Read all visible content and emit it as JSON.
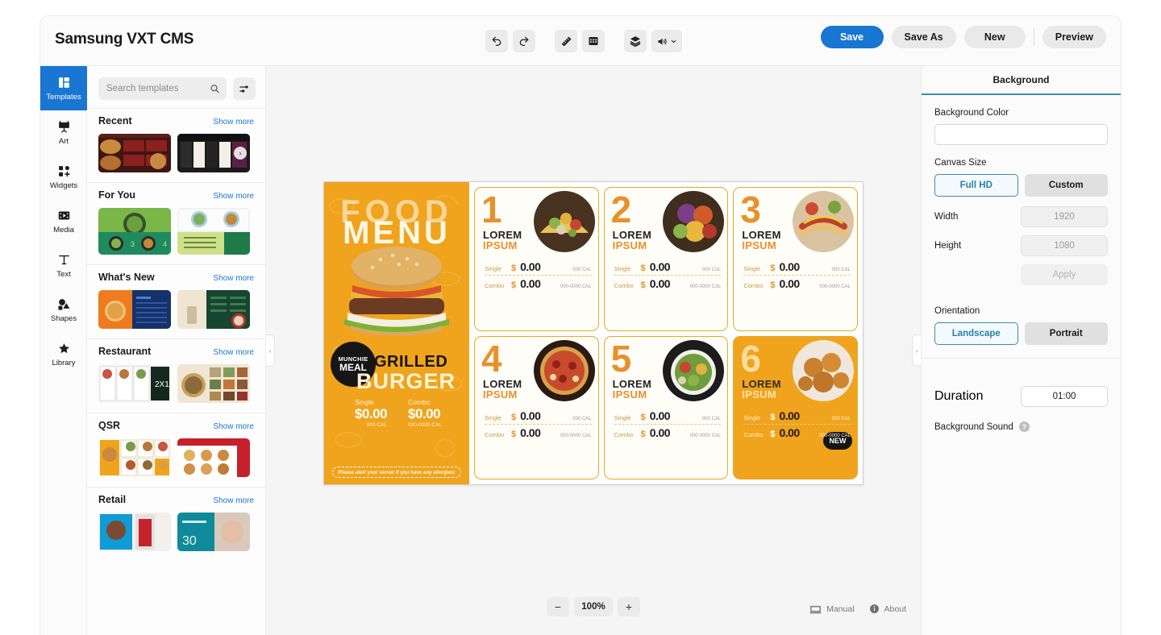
{
  "app": {
    "title": "Samsung VXT CMS"
  },
  "toolbar": {
    "buttons": [
      {
        "name": "undo",
        "label": "Undo"
      },
      {
        "name": "redo",
        "label": "Redo"
      },
      {
        "name": "ruler",
        "label": "Ruler"
      },
      {
        "name": "schedule",
        "label": "Schedule"
      },
      {
        "name": "layers",
        "label": "Layers"
      },
      {
        "name": "volume",
        "label": "Volume"
      }
    ]
  },
  "actions": {
    "save": "Save",
    "save_as": "Save As",
    "new": "New",
    "preview": "Preview"
  },
  "sidebar": {
    "items": [
      {
        "label": "Templates",
        "icon": "templates-icon",
        "active": true
      },
      {
        "label": "Art",
        "icon": "art-icon",
        "active": false
      },
      {
        "label": "Widgets",
        "icon": "widgets-icon",
        "active": false
      },
      {
        "label": "Media",
        "icon": "media-icon",
        "active": false
      },
      {
        "label": "Text",
        "icon": "text-icon",
        "active": false
      },
      {
        "label": "Shapes",
        "icon": "shapes-icon",
        "active": false
      },
      {
        "label": "Library",
        "icon": "library-icon",
        "active": false
      }
    ]
  },
  "templates": {
    "search_placeholder": "Search templates",
    "search_value": "",
    "filter_icon": "filter-sliders-icon",
    "show_more": "Show more",
    "sections": [
      {
        "title": "Recent"
      },
      {
        "title": "For You"
      },
      {
        "title": "What's New"
      },
      {
        "title": "Restaurant"
      },
      {
        "title": "QSR"
      },
      {
        "title": "Retail"
      }
    ]
  },
  "canvas": {
    "zoom": "100%",
    "zoom_out": "−",
    "zoom_in": "+",
    "manual": "Manual",
    "about": "About",
    "collapse_left": "‹",
    "collapse_right": "›",
    "design": {
      "hero": {
        "title_line1": "FOOD",
        "title_line2": "MENU",
        "badge_line1": "MUNCHIE",
        "badge_line2": "MEAL",
        "item_line1": "GRILLED",
        "item_line2": "BURGER",
        "single_label": "Single",
        "single_price": "$0.00",
        "single_cal": "000 CAL",
        "combo_label": "Combo",
        "combo_price": "$0.00",
        "combo_cal": "000-0000 CAL",
        "allergy_note": "Please alert your server if you have any allergies!"
      },
      "cards": [
        {
          "number": "1",
          "title1": "LOREM",
          "title2": "IPSUM",
          "single_label": "Single",
          "single_price": "0.00",
          "single_cal": "000 CAL",
          "combo_label": "Combo",
          "combo_price": "0.00",
          "combo_cal": "000-0000 CAL",
          "badge": "",
          "highlight": false
        },
        {
          "number": "2",
          "title1": "LOREM",
          "title2": "IPSUM",
          "single_label": "Single",
          "single_price": "0.00",
          "single_cal": "000 CAL",
          "combo_label": "Combo",
          "combo_price": "0.00",
          "combo_cal": "000-0000 CAL",
          "badge": "",
          "highlight": false
        },
        {
          "number": "3",
          "title1": "LOREM",
          "title2": "IPSUM",
          "single_label": "Single",
          "single_price": "0.00",
          "single_cal": "000 CAL",
          "combo_label": "Combo",
          "combo_price": "0.00",
          "combo_cal": "000-0000 CAL",
          "badge": "",
          "highlight": false
        },
        {
          "number": "4",
          "title1": "LOREM",
          "title2": "IPSUM",
          "single_label": "Single",
          "single_price": "0.00",
          "single_cal": "000 CAL",
          "combo_label": "Combo",
          "combo_price": "0.00",
          "combo_cal": "000-0000 CAL",
          "badge": "",
          "highlight": false
        },
        {
          "number": "5",
          "title1": "LOREM",
          "title2": "IPSUM",
          "single_label": "Single",
          "single_price": "0.00",
          "single_cal": "000 CAL",
          "combo_label": "Combo",
          "combo_price": "0.00",
          "combo_cal": "000-0000 CAL",
          "badge": "",
          "highlight": false
        },
        {
          "number": "6",
          "title1": "LOREM",
          "title2": "IPSUM",
          "single_label": "Single",
          "single_price": "0.00",
          "single_cal": "000 CAL",
          "combo_label": "Combo",
          "combo_price": "0.00",
          "combo_cal": "000-0000 CAL",
          "badge": "NEW",
          "highlight": true
        }
      ],
      "currency": "$"
    }
  },
  "properties": {
    "tab": "Background",
    "background_color_label": "Background Color",
    "background_color_value": "",
    "canvas_size_label": "Canvas Size",
    "full_hd": "Full HD",
    "custom": "Custom",
    "width_label": "Width",
    "width_value": "1920",
    "height_label": "Height",
    "height_value": "1080",
    "apply": "Apply",
    "orientation_label": "Orientation",
    "landscape": "Landscape",
    "portrait": "Portrait",
    "duration_label": "Duration",
    "duration_value": "01:00",
    "background_sound_label": "Background Sound",
    "help_icon": "?"
  },
  "colors": {
    "accent_blue": "#1976d2",
    "tab_underline": "#3e8ea8",
    "menu_orange": "#f0a31c"
  }
}
